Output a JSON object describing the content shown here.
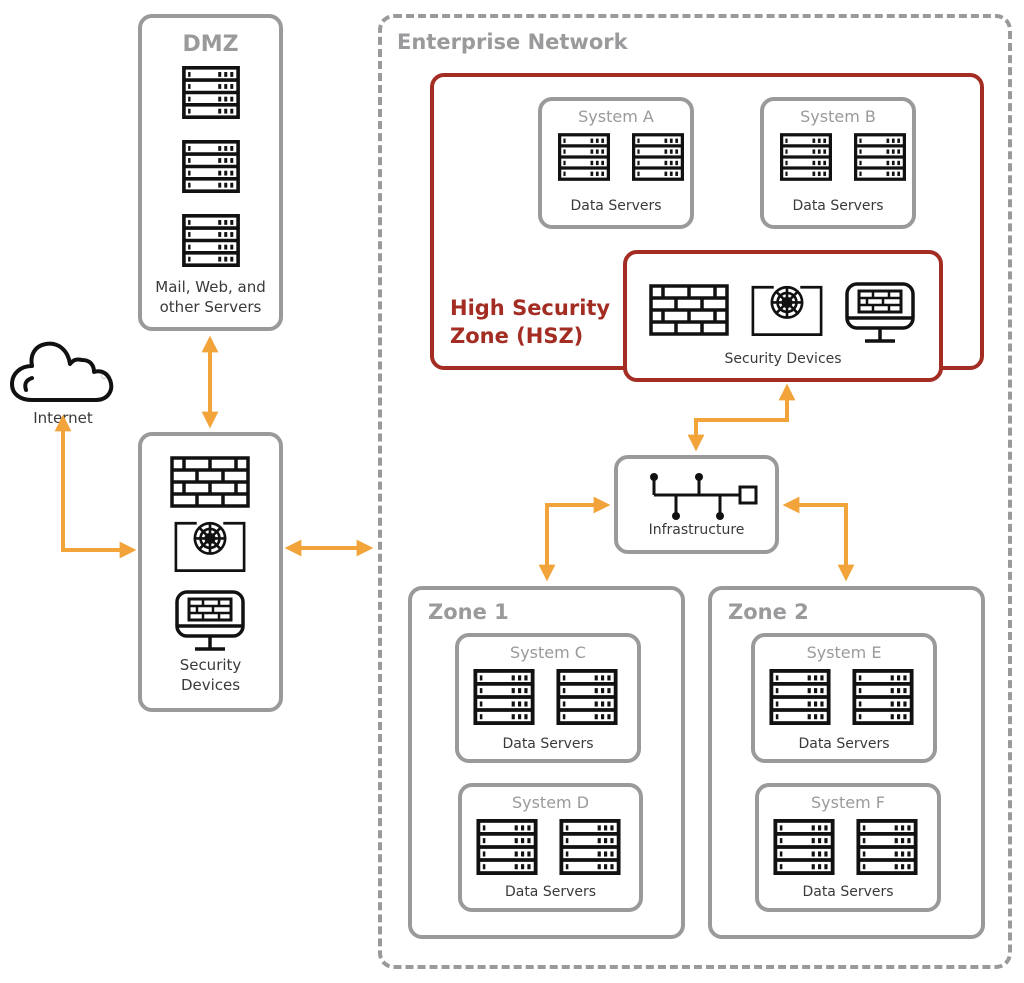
{
  "diagram": {
    "type": "network-architecture",
    "accent_color": "#f2a33a",
    "hsz_color": "#a32d23",
    "border_gray": "#9a9a9c"
  },
  "internet": {
    "label": "Internet",
    "icon": "cloud-icon"
  },
  "dmz": {
    "title": "DMZ",
    "icons": [
      "server-rack-icon",
      "server-rack-icon",
      "server-rack-icon"
    ],
    "caption_line1": "Mail, Web, and",
    "caption_line2": "other Servers"
  },
  "perimeter_security": {
    "icons": [
      "firewall-icon",
      "intrusion-detection-icon",
      "monitor-firewall-icon"
    ],
    "caption_line1": "Security",
    "caption_line2": "Devices"
  },
  "enterprise": {
    "title": "Enterprise Network",
    "hsz": {
      "title_line1": "High Security",
      "title_line2": "Zone (HSZ)",
      "systems": [
        {
          "title": "System A",
          "caption": "Data Servers"
        },
        {
          "title": "System B",
          "caption": "Data Servers"
        }
      ],
      "security_devices": {
        "icons": [
          "firewall-icon",
          "intrusion-detection-icon",
          "monitor-firewall-icon"
        ],
        "caption": "Security Devices"
      }
    },
    "infrastructure": {
      "label": "Infrastructure",
      "icon": "network-bus-icon"
    },
    "zones": [
      {
        "title": "Zone 1",
        "systems": [
          {
            "title": "System C",
            "caption": "Data Servers"
          },
          {
            "title": "System D",
            "caption": "Data Servers"
          }
        ]
      },
      {
        "title": "Zone 2",
        "systems": [
          {
            "title": "System E",
            "caption": "Data Servers"
          },
          {
            "title": "System F",
            "caption": "Data Servers"
          }
        ]
      }
    ]
  },
  "connections": [
    {
      "from": "Internet",
      "to": "Security Devices (perimeter)",
      "direction": "bidirectional"
    },
    {
      "from": "DMZ",
      "to": "Security Devices (perimeter)",
      "direction": "bidirectional"
    },
    {
      "from": "Security Devices (perimeter)",
      "to": "Enterprise Network",
      "direction": "bidirectional"
    },
    {
      "from": "Infrastructure",
      "to": "HSZ Security Devices",
      "direction": "bidirectional"
    },
    {
      "from": "Infrastructure",
      "to": "Zone 1",
      "direction": "bidirectional"
    },
    {
      "from": "Infrastructure",
      "to": "Zone 2",
      "direction": "bidirectional"
    }
  ]
}
